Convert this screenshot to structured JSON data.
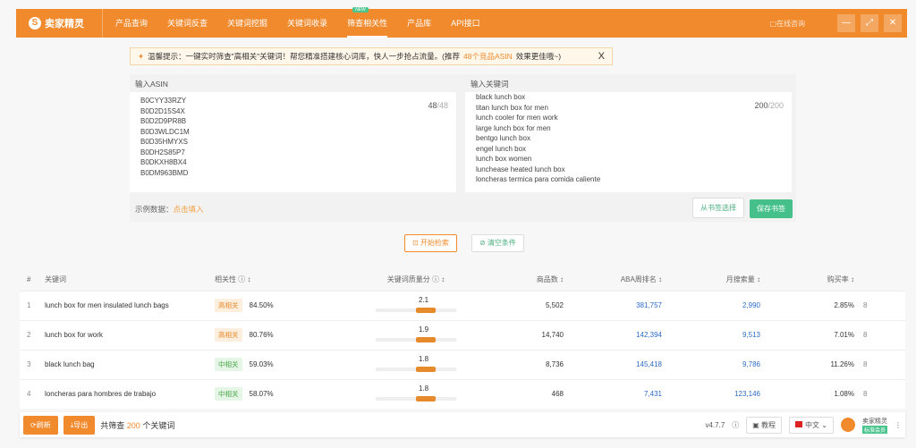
{
  "app": {
    "logo": "卖家精灵",
    "nav": [
      "产品查询",
      "关键词反查",
      "关键词挖掘",
      "关键词收录",
      "筛查相关性",
      "产品库",
      "API接口"
    ],
    "active_nav": 4,
    "new_badge": "NEW",
    "window_link": "▢在线咨询",
    "win_buttons": [
      "—",
      "⤢",
      "✕"
    ]
  },
  "notice": {
    "text": "温馨提示：一键实时筛查\"高相关\"关键词！帮您精准搭建核心词库，快人一步抢占流量。(推荐",
    "highlight": "48个竞品ASIN",
    "tail": "效果更佳哦~)",
    "close": "X"
  },
  "asin_panel": {
    "label": "输入ASIN",
    "count": "48",
    "max": "/48",
    "items": [
      "B0CYY33RZY",
      "B0D2D15S4X",
      "B0D2D9PR8B",
      "B0D3WLDC1M",
      "B0D35HMYXS",
      "B0DH2S85P7",
      "B0DKXH8BX4",
      "B0DM963BMD"
    ],
    "example_label": "示例数据：",
    "example_link": "点击填入"
  },
  "keyword_panel": {
    "label": "输入关键词",
    "count": "200",
    "max": "/200",
    "items": [
      "black lunch box",
      "titan lunch box for men",
      "lunch cooler for men work",
      "large lunch box for men",
      "bentgo lunch box",
      "engel lunch box",
      "lunch box women",
      "lunchease heated lunch box",
      "loncheras termica para comida caliente"
    ],
    "from_book": "从书签选择",
    "save_book": "保存书签"
  },
  "actions": {
    "start": "⊡ 开始检索",
    "clear": "⊘ 清空条件"
  },
  "table": {
    "headers": [
      "#",
      "关键词",
      "相关性 ⓘ ↕",
      "关键词质量分 ⓘ ↕",
      "商品数 ↕",
      "ABA周排名 ↕",
      "月搜索量 ↕",
      "购买率 ↕"
    ],
    "rows": [
      {
        "n": "1",
        "kw": "lunch box for men insulated lunch bags",
        "tag": "高相关",
        "tagtype": "hi",
        "pct": "84.50%",
        "score": "2.1",
        "products": "5,502",
        "aba": "381,757",
        "monthly": "2,990",
        "rate": "2.85%",
        "extra": "8"
      },
      {
        "n": "2",
        "kw": "lunch box for work",
        "tag": "高相关",
        "tagtype": "hi",
        "pct": "80.76%",
        "score": "1.9",
        "products": "14,740",
        "aba": "142,394",
        "monthly": "9,513",
        "rate": "7.01%",
        "extra": "8"
      },
      {
        "n": "3",
        "kw": "black lunch bag",
        "tag": "中相关",
        "tagtype": "md",
        "pct": "59.03%",
        "score": "1.8",
        "products": "8,736",
        "aba": "145,418",
        "monthly": "9,786",
        "rate": "11.26%",
        "extra": "8"
      },
      {
        "n": "4",
        "kw": "loncheras para hombres de trabajo",
        "tag": "中相关",
        "tagtype": "md",
        "pct": "58.07%",
        "score": "1.8",
        "products": "468",
        "aba": "7,431",
        "monthly": "123,146",
        "rate": "1.08%",
        "extra": "8"
      }
    ]
  },
  "footer": {
    "refresh": "⟳刷新",
    "export": "⤓导出",
    "summary_pre": "共筛查",
    "summary_num": "200",
    "summary_post": "个关键词",
    "version": "v4.7.7",
    "help": "ⓘ",
    "tutorial": "▣ 教程",
    "lang": "中文",
    "user": "卖家精灵",
    "user_badge": "标准会员",
    "menu": "⋮"
  }
}
